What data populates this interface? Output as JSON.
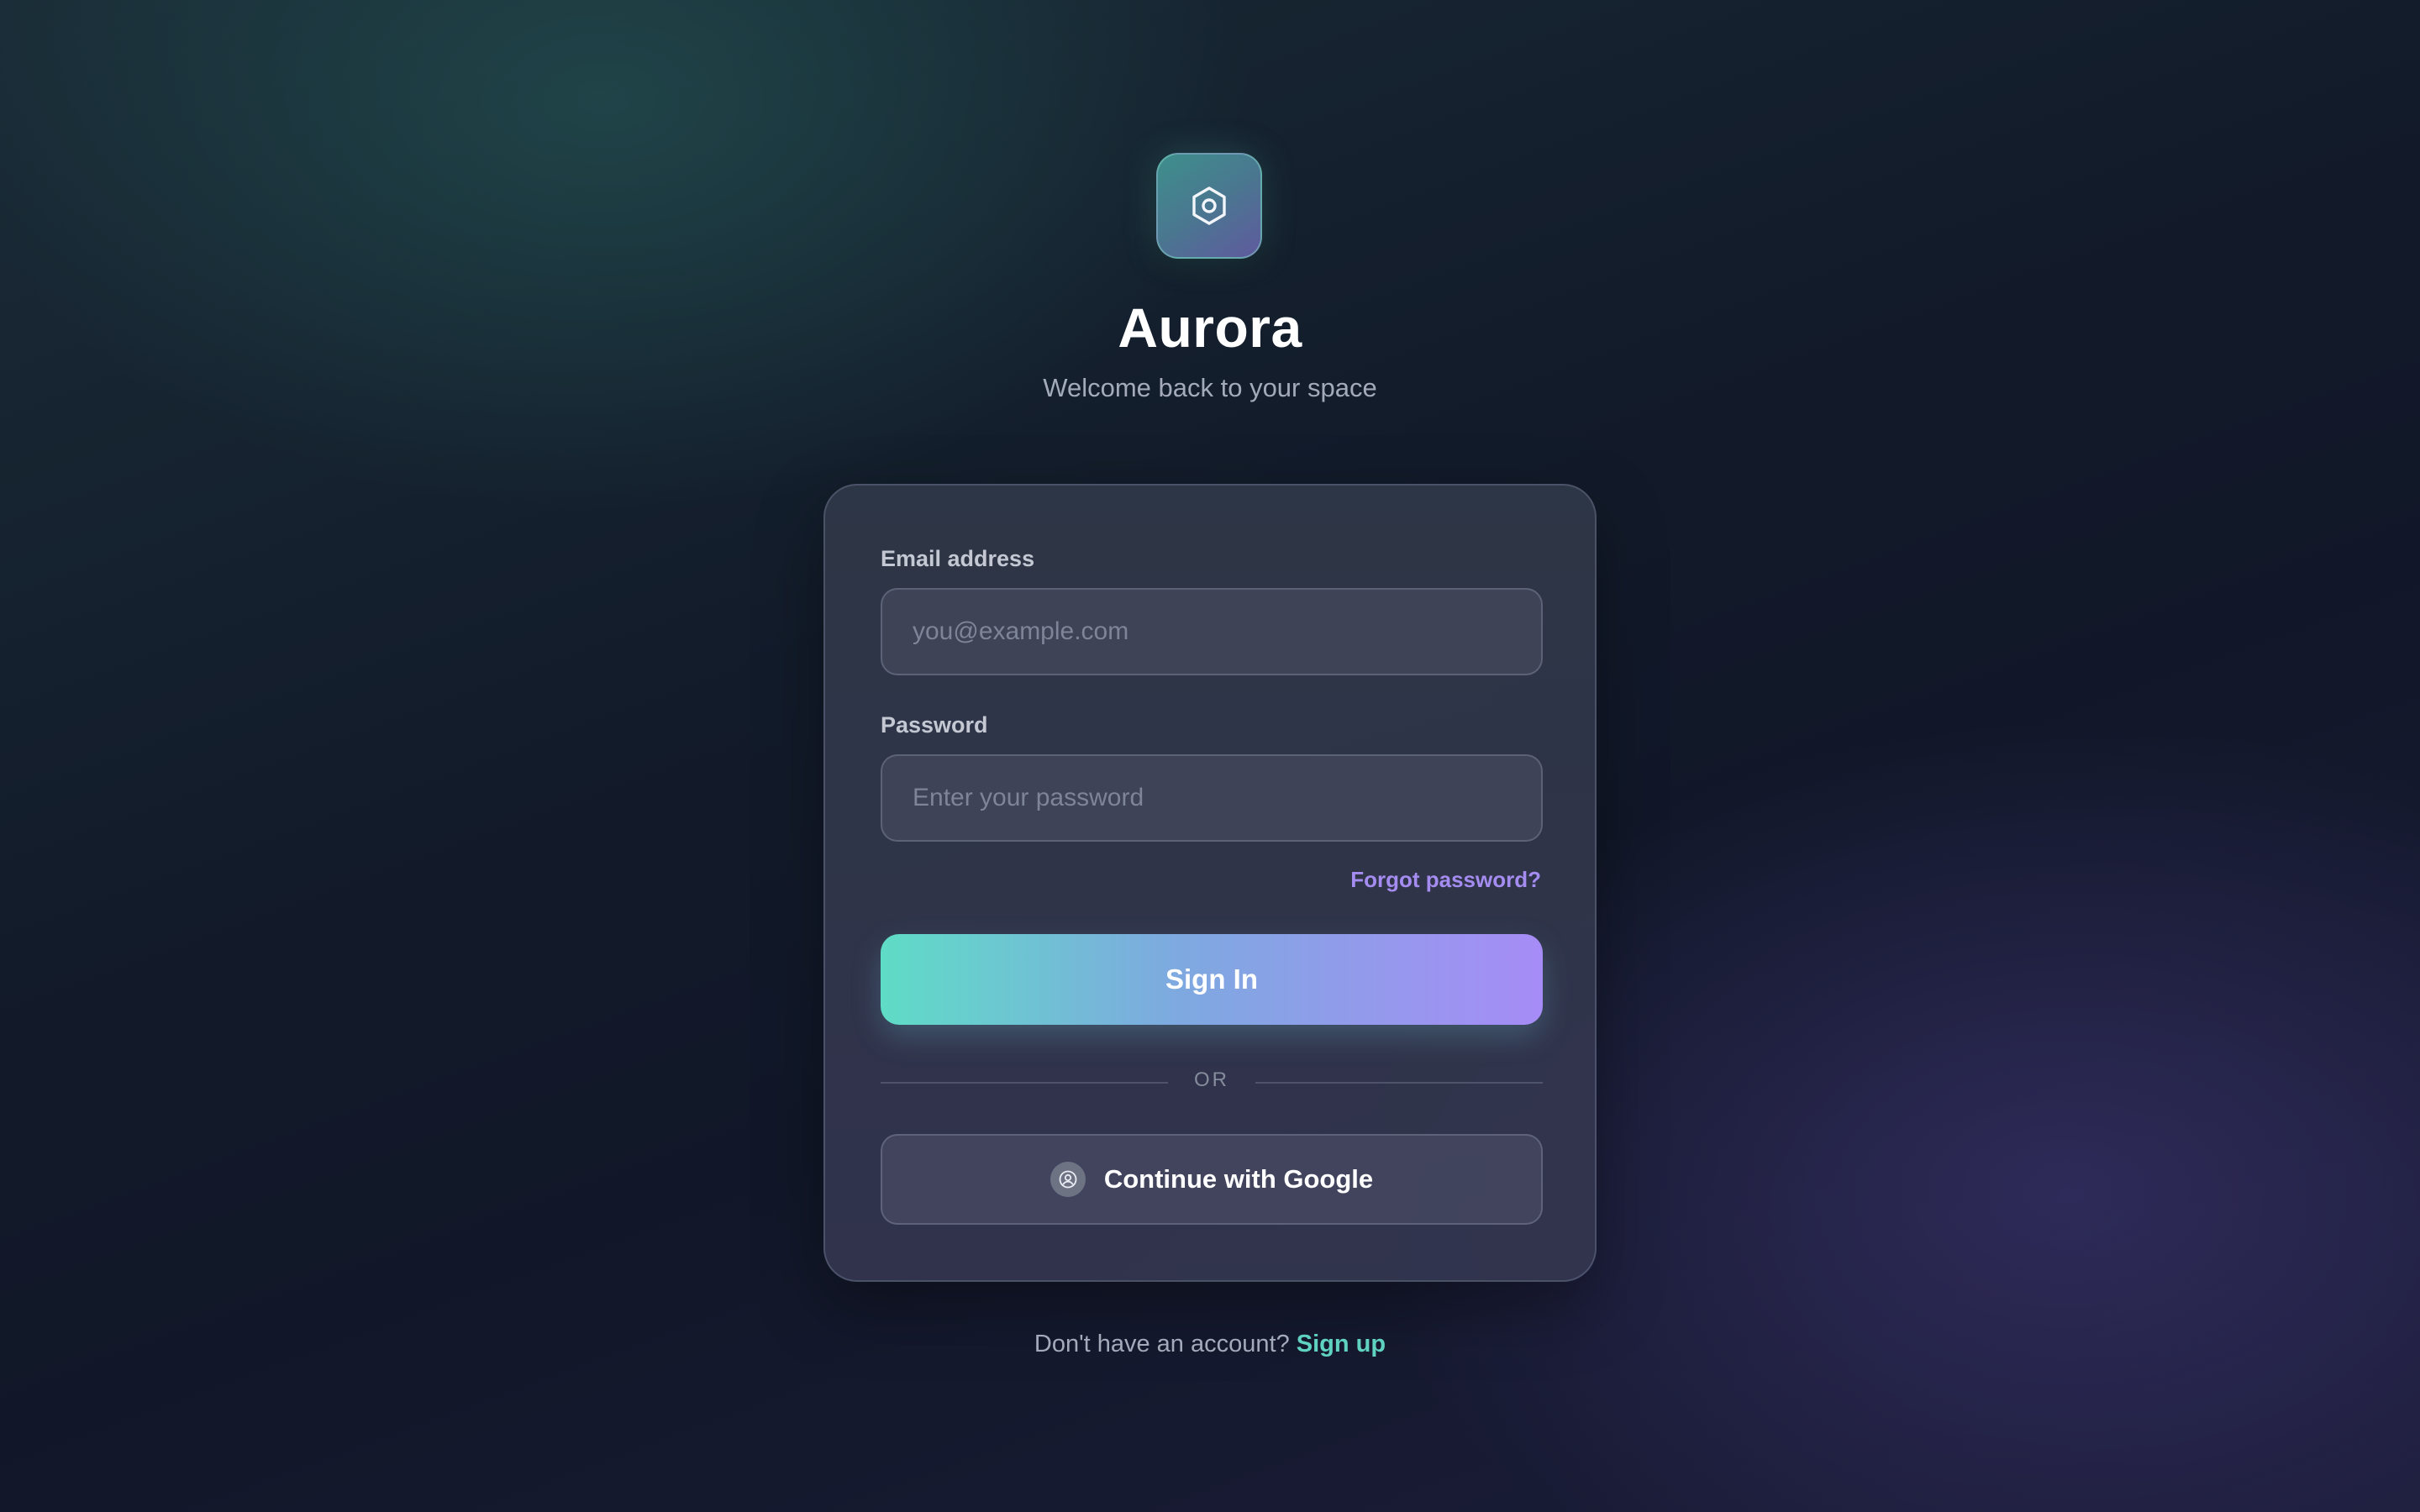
{
  "brand": {
    "name": "Aurora",
    "tagline": "Welcome back to your space",
    "logo_icon": "hexagon-icon"
  },
  "login_form": {
    "email": {
      "label": "Email address",
      "placeholder": "you@example.com",
      "value": ""
    },
    "password": {
      "label": "Password",
      "placeholder": "Enter your password",
      "value": ""
    },
    "forgot_password_link": "Forgot password?",
    "sign_in_button": "Sign In",
    "divider_text": "OR",
    "google_button": "Continue with Google",
    "google_icon": "user-circle-icon"
  },
  "signup": {
    "prompt": "Don't have an account?",
    "link": "Sign up"
  },
  "colors": {
    "accent_teal": "#5fdcc6",
    "accent_purple": "#a68cf6",
    "link_purple": "#a58cf0",
    "link_teal": "#5fd3c0"
  }
}
